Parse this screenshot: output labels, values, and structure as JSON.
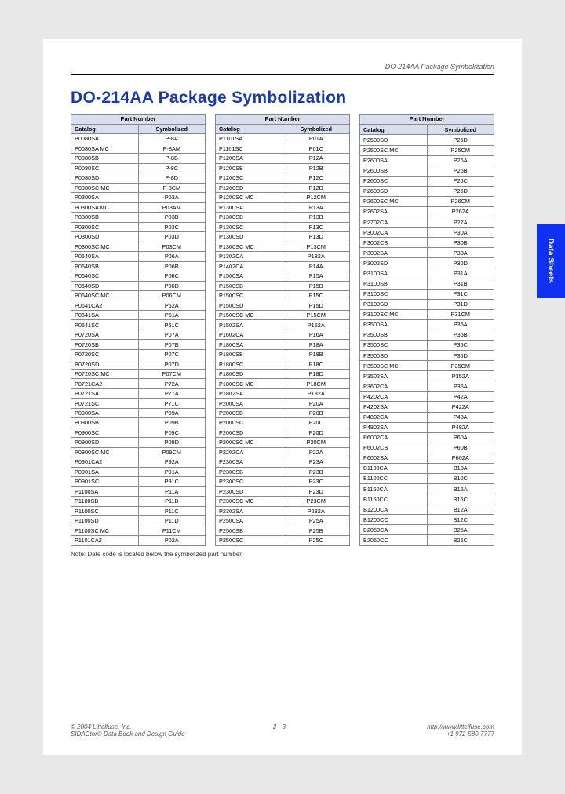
{
  "header_meta": "DO-214AA Package Symbolization",
  "title": "DO-214AA Package Symbolization",
  "side_tab": "Data Sheets",
  "note": "Note: Date code is located below the symbolized part number.",
  "footer": {
    "copyright": "© 2004 Littelfuse, Inc.",
    "guide": "SIDACtor® Data Book and Design Guide",
    "page": "2 - 3",
    "url": "http://www.littelfuse.com",
    "phone": "+1 972-580-7777"
  },
  "table_header_group": "Part Number",
  "table_header_cols": [
    "Catalog",
    "Symbolized"
  ],
  "tables": [
    [
      [
        "P0080SA",
        "P-8A"
      ],
      [
        "P0080SA MC",
        "P-8AM"
      ],
      [
        "P0080SB",
        "P-8B"
      ],
      [
        "P0080SC",
        "P-8C"
      ],
      [
        "P0080SD",
        "P-8D"
      ],
      [
        "P0080SC MC",
        "P-8CM"
      ],
      [
        "P0300SA",
        "P03A"
      ],
      [
        "P0300SA MC",
        "P03AM"
      ],
      [
        "P0300SB",
        "P03B"
      ],
      [
        "P0300SC",
        "P03C"
      ],
      [
        "P0300SD",
        "P03D"
      ],
      [
        "P0300SC MC",
        "P03CM"
      ],
      [
        "P0640SA",
        "P06A"
      ],
      [
        "P0640SB",
        "P06B"
      ],
      [
        "P0640SC",
        "P06C"
      ],
      [
        "P0640SD",
        "P06D"
      ],
      [
        "P0640SC MC",
        "P06CM"
      ],
      [
        "P0641CA2",
        "P62A"
      ],
      [
        "P0641SA",
        "P61A"
      ],
      [
        "P0641SC",
        "P61C"
      ],
      [
        "P0720SA",
        "P07A"
      ],
      [
        "P0720SB",
        "P07B"
      ],
      [
        "P0720SC",
        "P07C"
      ],
      [
        "P0720SD",
        "P07D"
      ],
      [
        "P0720SC MC",
        "P07CM"
      ],
      [
        "P0721CA2",
        "P72A"
      ],
      [
        "P0721SA",
        "P71A"
      ],
      [
        "P0721SC",
        "P71C"
      ],
      [
        "P0900SA",
        "P09A"
      ],
      [
        "P0900SB",
        "P09B"
      ],
      [
        "P0900SC",
        "P09C"
      ],
      [
        "P0900SD",
        "P09D"
      ],
      [
        "P0900SC MC",
        "P09CM"
      ],
      [
        "P0901CA2",
        "P92A"
      ],
      [
        "P0901SA",
        "P91A"
      ],
      [
        "P0901SC",
        "P91C"
      ],
      [
        "P1100SA",
        "P11A"
      ],
      [
        "P1100SB",
        "P11B"
      ],
      [
        "P1100SC",
        "P11C"
      ],
      [
        "P1100SD",
        "P11D"
      ],
      [
        "P1100SC MC",
        "P11CM"
      ],
      [
        "P1101CA2",
        "P02A"
      ]
    ],
    [
      [
        "P1101SA",
        "P01A"
      ],
      [
        "P1101SC",
        "P01C"
      ],
      [
        "P1200SA",
        "P12A"
      ],
      [
        "P1200SB",
        "P12B"
      ],
      [
        "P1200SC",
        "P12C"
      ],
      [
        "P1200SD",
        "P12D"
      ],
      [
        "P1200SC MC",
        "P12CM"
      ],
      [
        "P1300SA",
        "P13A"
      ],
      [
        "P1300SB",
        "P13B"
      ],
      [
        "P1300SC",
        "P13C"
      ],
      [
        "P1300SD",
        "P13D"
      ],
      [
        "P1300SC MC",
        "P13CM"
      ],
      [
        "P1302CA",
        "P132A"
      ],
      [
        "P1402CA",
        "P14A"
      ],
      [
        "P1500SA",
        "P15A"
      ],
      [
        "P1500SB",
        "P15B"
      ],
      [
        "P1500SC",
        "P15C"
      ],
      [
        "P1500SD",
        "P15D"
      ],
      [
        "P1500SC MC",
        "P15CM"
      ],
      [
        "P1502SA",
        "P152A"
      ],
      [
        "P1602CA",
        "P16A"
      ],
      [
        "P1800SA",
        "P18A"
      ],
      [
        "P1800SB",
        "P18B"
      ],
      [
        "P1800SC",
        "P18C"
      ],
      [
        "P1800SD",
        "P18D"
      ],
      [
        "P1800SC MC",
        "P18CM"
      ],
      [
        "P1802SA",
        "P182A"
      ],
      [
        "P2000SA",
        "P20A"
      ],
      [
        "P2000SB",
        "P20B"
      ],
      [
        "P2000SC",
        "P20C"
      ],
      [
        "P2000SD",
        "P20D"
      ],
      [
        "P2000SC MC",
        "P20CM"
      ],
      [
        "P2202CA",
        "P22A"
      ],
      [
        "P2300SA",
        "P23A"
      ],
      [
        "P2300SB",
        "P23B"
      ],
      [
        "P2300SC",
        "P23C"
      ],
      [
        "P2300SD",
        "P23D"
      ],
      [
        "P2300SC MC",
        "P23CM"
      ],
      [
        "P2302SA",
        "P232A"
      ],
      [
        "P2500SA",
        "P25A"
      ],
      [
        "P2500SB",
        "P25B"
      ],
      [
        "P2500SC",
        "P25C"
      ]
    ],
    [
      [
        "P2500SD",
        "P25D"
      ],
      [
        "P2500SC MC",
        "P25CM"
      ],
      [
        "P2600SA",
        "P26A"
      ],
      [
        "P2600SB",
        "P26B"
      ],
      [
        "P2600SC",
        "P26C"
      ],
      [
        "P2600SD",
        "P26D"
      ],
      [
        "P2600SC MC",
        "P26CM"
      ],
      [
        "P2602SA",
        "P262A"
      ],
      [
        "P2702CA",
        "P27A"
      ],
      [
        "P3002CA",
        "P30A"
      ],
      [
        "P3002CB",
        "P30B"
      ],
      [
        "P3002SA",
        "P30A"
      ],
      [
        "P3002SD",
        "P30D"
      ],
      [
        "P3100SA",
        "P31A"
      ],
      [
        "P3100SB",
        "P31B"
      ],
      [
        "P3100SC",
        "P31C"
      ],
      [
        "P3100SD",
        "P31D"
      ],
      [
        "P3100SC MC",
        "P31CM"
      ],
      [
        "P3500SA",
        "P35A"
      ],
      [
        "P3500SB",
        "P35B"
      ],
      [
        "P3500SC",
        "P35C"
      ],
      [
        "P3500SD",
        "P35D"
      ],
      [
        "P3500SC MC",
        "P35CM"
      ],
      [
        "P3502SA",
        "P352A"
      ],
      [
        "P3602CA",
        "P36A"
      ],
      [
        "P4202CA",
        "P42A"
      ],
      [
        "P4202SA",
        "P422A"
      ],
      [
        "P4802CA",
        "P48A"
      ],
      [
        "P4802SA",
        "P482A"
      ],
      [
        "P6002CA",
        "P60A"
      ],
      [
        "P6002CB",
        "P60B"
      ],
      [
        "P6002SA",
        "P602A"
      ],
      [
        "B1100CA",
        "B10A"
      ],
      [
        "B1100CC",
        "B10C"
      ],
      [
        "B1160CA",
        "B16A"
      ],
      [
        "B1160CC",
        "B16C"
      ],
      [
        "B1200CA",
        "B12A"
      ],
      [
        "B1200CC",
        "B12C"
      ],
      [
        "B2050CA",
        "B25A"
      ],
      [
        "B2050CC",
        "B25C"
      ]
    ]
  ]
}
